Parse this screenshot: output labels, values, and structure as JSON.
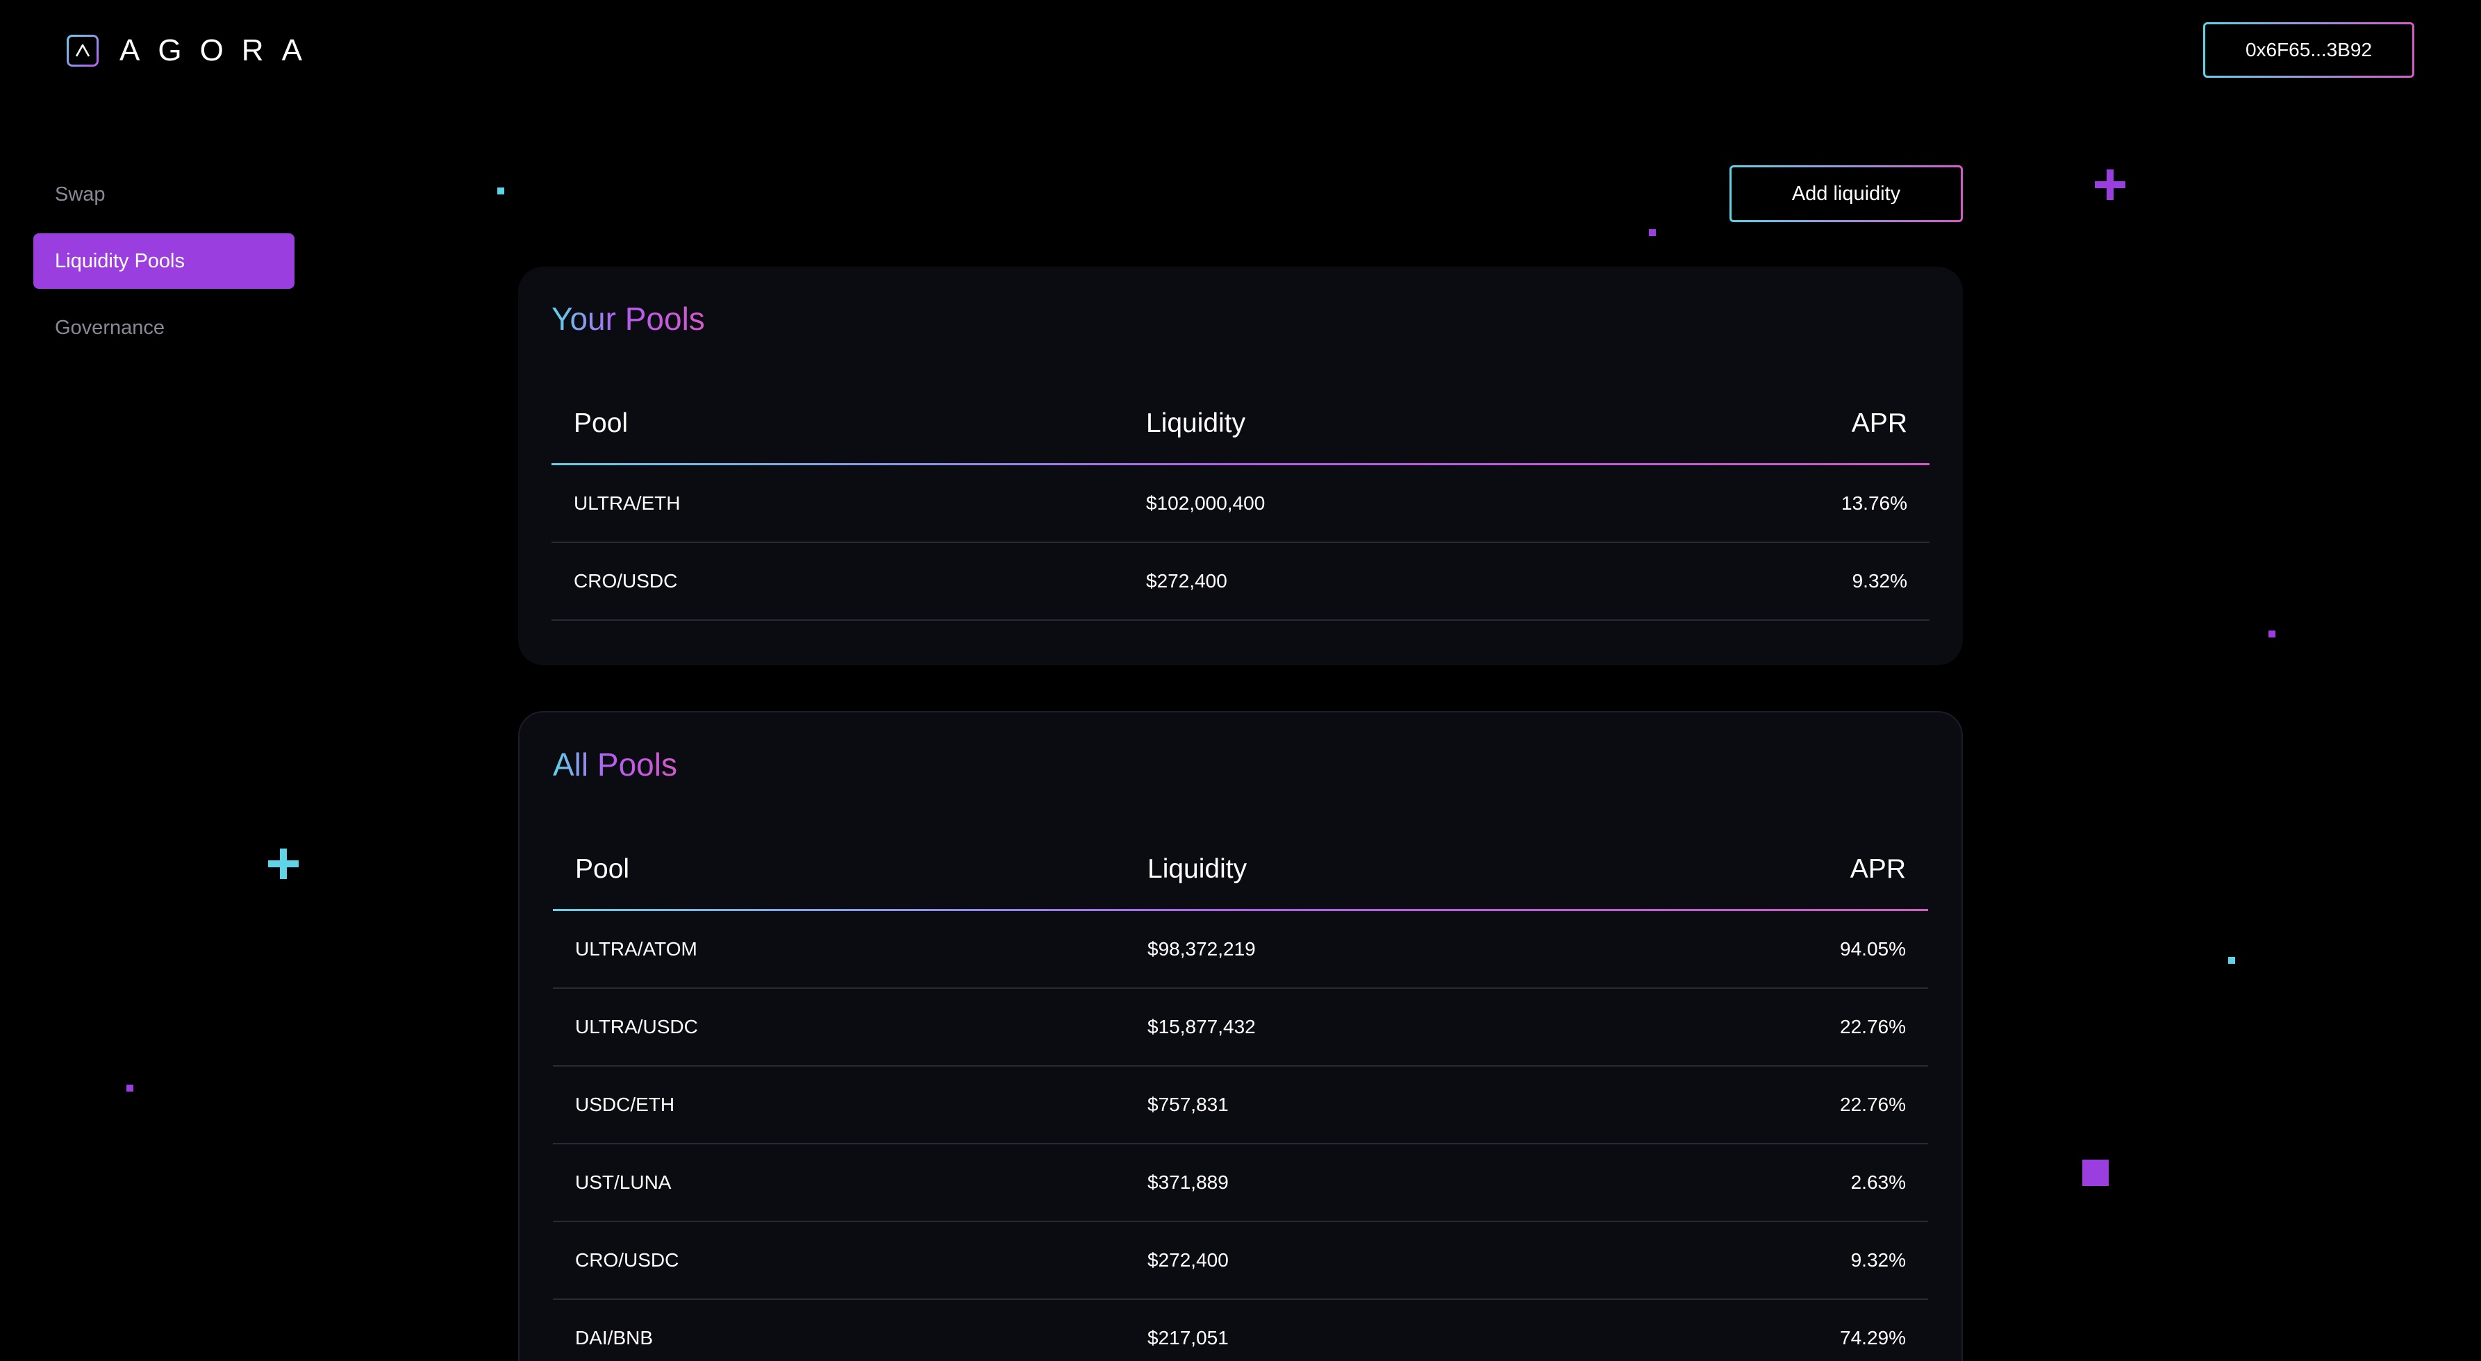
{
  "header": {
    "logo_text": "AGORA",
    "wallet_address": "0x6F65...3B92"
  },
  "sidebar": {
    "items": [
      {
        "label": "Swap",
        "active": false
      },
      {
        "label": "Liquidity Pools",
        "active": true
      },
      {
        "label": "Governance",
        "active": false
      }
    ]
  },
  "actions": {
    "add_liquidity_label": "Add liquidity"
  },
  "your_pools": {
    "title": "Your Pools",
    "columns": [
      "Pool",
      "Liquidity",
      "APR"
    ],
    "rows": [
      {
        "pool": "ULTRA/ETH",
        "liquidity": "$102,000,400",
        "apr": "13.76%"
      },
      {
        "pool": "CRO/USDC",
        "liquidity": "$272,400",
        "apr": "9.32%"
      }
    ]
  },
  "all_pools": {
    "title": "All Pools",
    "columns": [
      "Pool",
      "Liquidity",
      "APR"
    ],
    "rows": [
      {
        "pool": "ULTRA/ATOM",
        "liquidity": "$98,372,219",
        "apr": "94.05%"
      },
      {
        "pool": "ULTRA/USDC",
        "liquidity": "$15,877,432",
        "apr": "22.76%"
      },
      {
        "pool": "USDC/ETH",
        "liquidity": "$757,831",
        "apr": "22.76%"
      },
      {
        "pool": "UST/LUNA",
        "liquidity": "$371,889",
        "apr": "2.63%"
      },
      {
        "pool": "CRO/USDC",
        "liquidity": "$272,400",
        "apr": "9.32%"
      },
      {
        "pool": "DAI/BNB",
        "liquidity": "$217,051",
        "apr": "74.29%"
      }
    ]
  },
  "colors": {
    "accent_purple": "#9a3ee0",
    "accent_cyan": "#5fd4e8",
    "accent_pink": "#d45ac8",
    "background": "#000000",
    "card_background": "#0b0b12"
  }
}
